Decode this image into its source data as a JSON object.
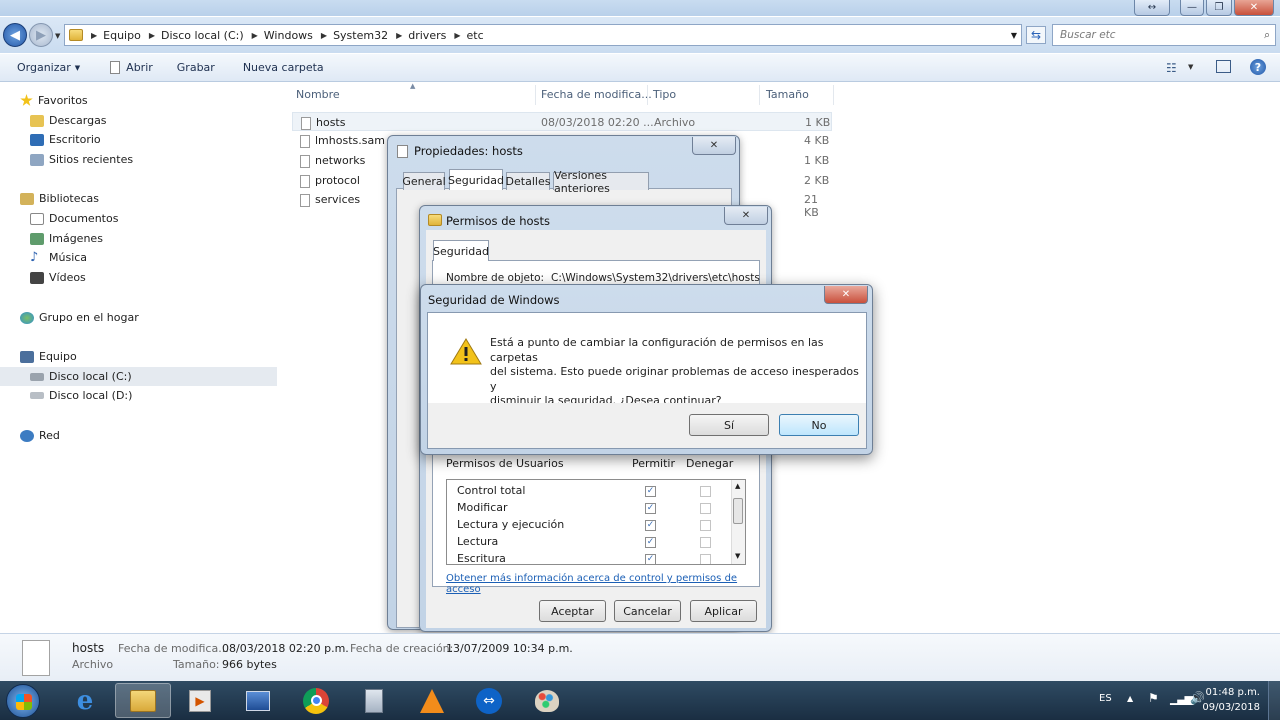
{
  "window": {
    "caption_buttons": [
      "↔",
      "—",
      "❐",
      "✕"
    ]
  },
  "address": {
    "crumbs": [
      "Equipo",
      "Disco local (C:)",
      "Windows",
      "System32",
      "drivers",
      "etc"
    ],
    "search_placeholder": "Buscar etc"
  },
  "toolbar": {
    "organize": "Organizar",
    "open": "Abrir",
    "record": "Grabar",
    "new_folder": "Nueva carpeta"
  },
  "sidebar": {
    "favorites": "Favoritos",
    "downloads": "Descargas",
    "desktop": "Escritorio",
    "recent": "Sitios recientes",
    "libraries": "Bibliotecas",
    "documents": "Documentos",
    "images": "Imágenes",
    "music": "Música",
    "videos": "Vídeos",
    "homegroup": "Grupo en el hogar",
    "computer": "Equipo",
    "disk_c": "Disco local (C:)",
    "disk_d": "Disco local (D:)",
    "network": "Red"
  },
  "columns": {
    "name": "Nombre",
    "date": "Fecha de modifica...",
    "type": "Tipo",
    "size": "Tamaño"
  },
  "files": [
    {
      "name": "hosts",
      "date": "08/03/2018 02:20 ...",
      "type": "Archivo",
      "size": "1 KB"
    },
    {
      "name": "lmhosts.sam",
      "date": "",
      "type": "",
      "size": "4 KB"
    },
    {
      "name": "networks",
      "date": "",
      "type": "",
      "size": "1 KB"
    },
    {
      "name": "protocol",
      "date": "",
      "type": "",
      "size": "2 KB"
    },
    {
      "name": "services",
      "date": "",
      "type": "",
      "size": "21 KB"
    }
  ],
  "props_dialog": {
    "title": "Propiedades: hosts",
    "tabs": [
      "General",
      "Seguridad",
      "Detalles",
      "Versiones anteriores"
    ]
  },
  "perm_dialog": {
    "title": "Permisos de hosts",
    "tab": "Seguridad",
    "object_label": "Nombre de objeto:",
    "object_path": "C:\\Windows\\System32\\drivers\\etc\\hosts",
    "perms_header": "Permisos de Usuarios",
    "allow": "Permitir",
    "deny": "Denegar",
    "perms": [
      {
        "name": "Control total",
        "allow": true,
        "deny": false
      },
      {
        "name": "Modificar",
        "allow": true,
        "deny": false
      },
      {
        "name": "Lectura y ejecución",
        "allow": true,
        "deny": false
      },
      {
        "name": "Lectura",
        "allow": true,
        "deny": false
      },
      {
        "name": "Escritura",
        "allow": true,
        "deny": false
      }
    ],
    "link": "Obtener más información acerca de control y permisos de acceso",
    "ok": "Aceptar",
    "cancel": "Cancelar",
    "apply": "Aplicar"
  },
  "security_dialog": {
    "title": "Seguridad de Windows",
    "message_line1": "Está a punto de cambiar la configuración de permisos en las carpetas",
    "message_line2": "del sistema. Esto puede originar problemas de acceso inesperados y",
    "message_line3": "disminuir la seguridad. ¿Desea continuar?",
    "yes": "Sí",
    "no": "No"
  },
  "details": {
    "filename": "hosts",
    "filetype": "Archivo",
    "mod_label": "Fecha de modifica...",
    "mod_value": "08/03/2018 02:20 p.m.",
    "size_label": "Tamaño:",
    "size_value": "966 bytes",
    "created_label": "Fecha de creación:",
    "created_value": "13/07/2009 10:34 p.m."
  },
  "taskbar": {
    "lang": "ES",
    "time": "01:48 p.m.",
    "date": "09/03/2018"
  },
  "colors": {
    "accent": "#3c7fb1",
    "taskbar": "#1f3449",
    "warning": "#f2c21a"
  }
}
